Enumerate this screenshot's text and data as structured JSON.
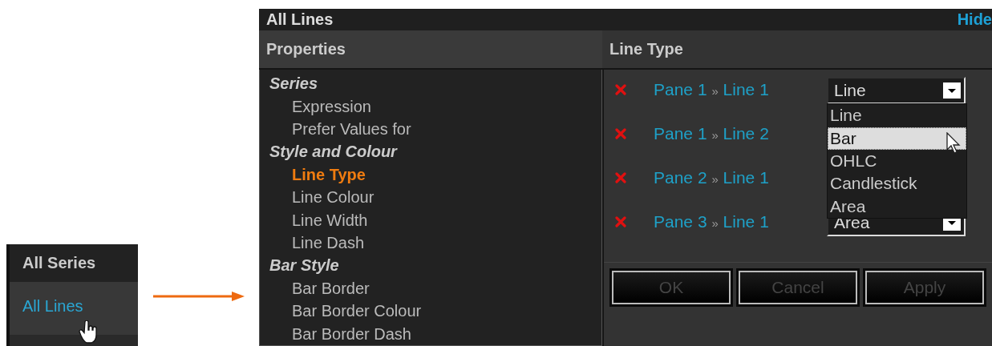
{
  "series_menu": {
    "items": [
      {
        "label": "All Series",
        "selected": false
      },
      {
        "label": "All Lines",
        "selected": true
      }
    ]
  },
  "window": {
    "title": "All Lines",
    "hide_link": "Hide"
  },
  "properties": {
    "heading": "Properties",
    "groups": [
      {
        "label": "Series",
        "children": [
          {
            "label": "Expression",
            "selected": false
          },
          {
            "label": "Prefer Values for",
            "selected": false
          }
        ]
      },
      {
        "label": "Style and Colour",
        "children": [
          {
            "label": "Line Type",
            "selected": true
          },
          {
            "label": "Line Colour",
            "selected": false
          },
          {
            "label": "Line Width",
            "selected": false
          },
          {
            "label": "Line Dash",
            "selected": false
          }
        ]
      },
      {
        "label": "Bar Style",
        "children": [
          {
            "label": "Bar Border",
            "selected": false
          },
          {
            "label": "Bar Border Colour",
            "selected": false
          },
          {
            "label": "Bar Border Dash",
            "selected": false
          }
        ]
      }
    ]
  },
  "line_type": {
    "heading": "Line Type",
    "rows": [
      {
        "pane": "Pane 1",
        "separator": "»",
        "line": "Line 1",
        "value": "Line",
        "open": true
      },
      {
        "pane": "Pane 1",
        "separator": "»",
        "line": "Line 2",
        "open": false
      },
      {
        "pane": "Pane 2",
        "separator": "»",
        "line": "Line 1",
        "open": false
      },
      {
        "pane": "Pane 3",
        "separator": "»",
        "line": "Line 1",
        "value": "Area",
        "open": false
      }
    ],
    "options": [
      {
        "label": "Line",
        "selected": false
      },
      {
        "label": "Bar",
        "selected": true
      },
      {
        "label": "OHLC",
        "selected": false
      },
      {
        "label": "Candlestick",
        "selected": false
      },
      {
        "label": "Area",
        "selected": false
      }
    ],
    "buttons": [
      {
        "label": "OK",
        "disabled": true
      },
      {
        "label": "Cancel",
        "disabled": true
      },
      {
        "label": "Apply",
        "disabled": true
      }
    ]
  }
}
